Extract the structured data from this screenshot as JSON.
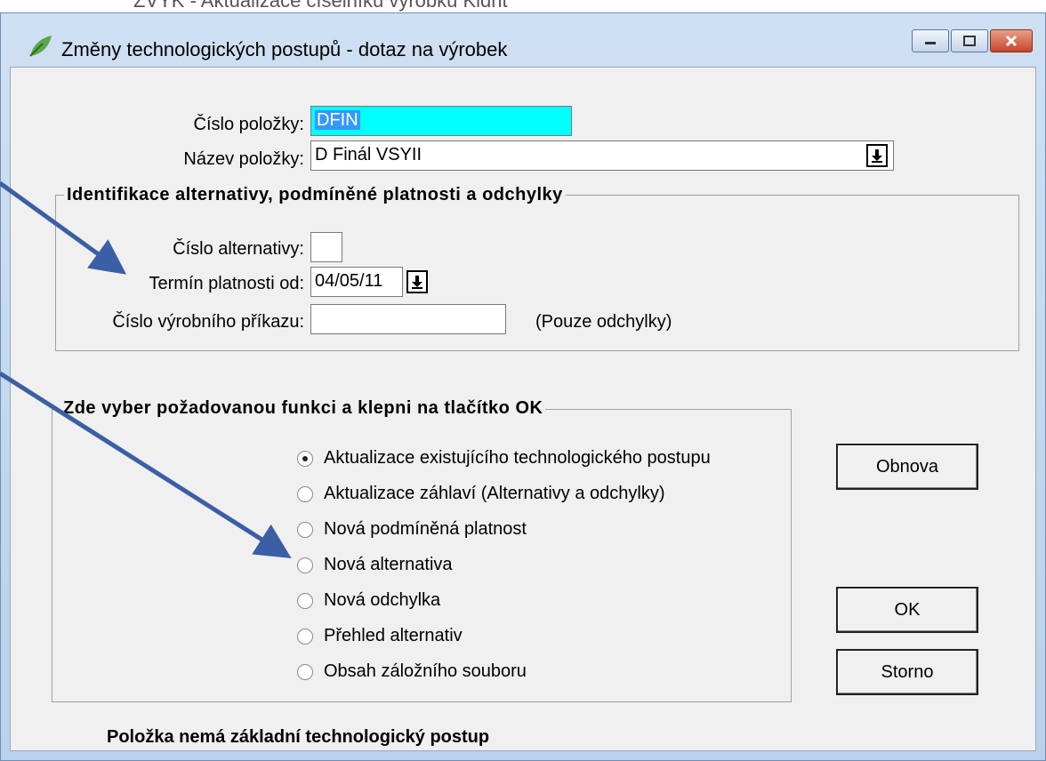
{
  "window": {
    "title": "Změny technologických postupů - dotaz na výrobek",
    "background_fragment": "ZVYK - Aktualizace číselníku výrobků Kidnt",
    "accent_color": "#3399ff"
  },
  "item": {
    "number_label": "Číslo položky:",
    "number_value": "DFIN",
    "name_label": "Název položky:",
    "name_value": "D Finál VSYII"
  },
  "identification": {
    "legend": "Identifikace alternativy, podmíněné platnosti a odchylky",
    "alt_label": "Číslo alternativy:",
    "alt_value": "",
    "date_label": "Termín platnosti od:",
    "date_value": "04/05/11",
    "order_label": "Číslo výrobního příkazu:",
    "order_value": "",
    "note": "(Pouze odchylky)"
  },
  "functions": {
    "legend": "Zde vyber požadovanou funkci a klepni na tlačítko OK",
    "options": [
      {
        "label": "Aktualizace existujícího technologického postupu",
        "selected": true
      },
      {
        "label": "Aktualizace záhlaví   (Alternativy a odchylky)",
        "selected": false
      },
      {
        "label": "Nová podmíněná platnost",
        "selected": false
      },
      {
        "label": "Nová alternativa",
        "selected": false
      },
      {
        "label": "Nová odchylka",
        "selected": false
      },
      {
        "label": "Přehled alternativ",
        "selected": false
      },
      {
        "label": "Obsah záložního souboru",
        "selected": false
      }
    ]
  },
  "buttons": {
    "refresh": "Obnova",
    "ok": "OK",
    "cancel": "Storno"
  },
  "status_message": "Položka nemá základní technologický postup",
  "annotation_arrow_color": "#3b5fa5"
}
